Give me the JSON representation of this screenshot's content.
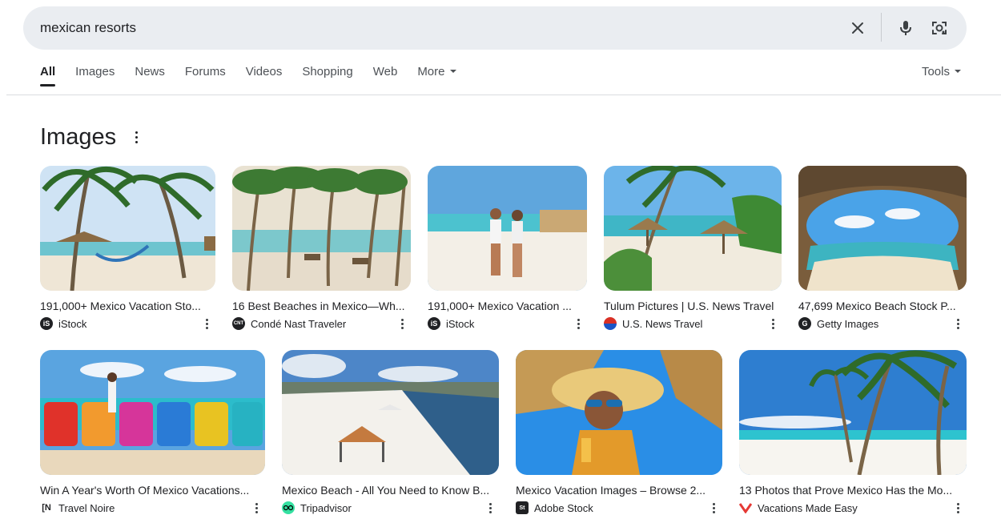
{
  "search": {
    "query": "mexican resorts"
  },
  "tabs": [
    {
      "label": "All"
    },
    {
      "label": "Images"
    },
    {
      "label": "News"
    },
    {
      "label": "Forums"
    },
    {
      "label": "Videos"
    },
    {
      "label": "Shopping"
    },
    {
      "label": "Web"
    },
    {
      "label": "More"
    }
  ],
  "tools_label": "Tools",
  "section_title": "Images",
  "cards": [
    {
      "title": "191,000+ Mexico Vacation Sto...",
      "source": "iStock"
    },
    {
      "title": "16 Best Beaches in Mexico—Wh...",
      "source": "Condé Nast Traveler"
    },
    {
      "title": "191,000+ Mexico Vacation ...",
      "source": "iStock"
    },
    {
      "title": "Tulum Pictures | U.S. News Travel",
      "source": "U.S. News Travel"
    },
    {
      "title": "47,699 Mexico Beach Stock P...",
      "source": "Getty Images"
    },
    {
      "title": "Win A Year's Worth Of Mexico Vacations...",
      "source": "Travel Noire"
    },
    {
      "title": "Mexico Beach - All You Need to Know B...",
      "source": "Tripadvisor"
    },
    {
      "title": "Mexico Vacation Images – Browse 2...",
      "source": "Adobe Stock"
    },
    {
      "title": "13 Photos that Prove Mexico Has the Mo...",
      "source": "Vacations Made Easy"
    }
  ],
  "favicon_glyphs": {
    "istock": "iS",
    "conde": "CNT",
    "getty": "G",
    "travelnoire": "[N",
    "adobe": "St"
  },
  "colors": {
    "search_bg": "#eaedf1",
    "text": "#202124",
    "muted": "#4d5156"
  }
}
